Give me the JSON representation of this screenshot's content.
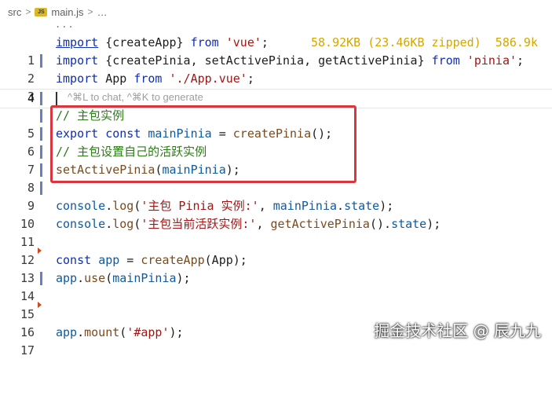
{
  "breadcrumb": {
    "folder": "src",
    "file_icon": "JS",
    "file": "main.js",
    "ellipsis": "…"
  },
  "fold_dots": "...",
  "editor": {
    "size_info": "58.92KB (23.46KB zipped)  586.9k",
    "hint": "^⌘L to chat, ^⌘K to generate",
    "line_numbers": [
      "1",
      "2",
      "3",
      "4",
      "5",
      "6",
      "7",
      "8",
      "9",
      "10",
      "11",
      "12",
      "13",
      "14",
      "15",
      "16",
      "17"
    ],
    "lines": {
      "l1": [
        "import",
        " {createApp} ",
        "from",
        " ",
        "'vue'",
        ";"
      ],
      "l2": [
        "import",
        " {createPinia, setActivePinia, getActivePinia} ",
        "from",
        " ",
        "'pinia'",
        ";"
      ],
      "l3": [
        "import",
        " App ",
        "from",
        " ",
        "'./App.vue'",
        ";"
      ],
      "l5": [
        "// 主包实例"
      ],
      "l6": [
        "export",
        " ",
        "const",
        " ",
        "mainPinia",
        " = ",
        "createPinia",
        "();"
      ],
      "l7": [
        "// 主包设置自己的活跃实例"
      ],
      "l8": [
        "setActivePinia",
        "(",
        "mainPinia",
        ");"
      ],
      "l10": [
        "console",
        ".",
        "log",
        "(",
        "'主包 Pinia 实例:'",
        ", ",
        "mainPinia",
        ".",
        "state",
        ");"
      ],
      "l11": [
        "console",
        ".",
        "log",
        "(",
        "'主包当前活跃实例:'",
        ", ",
        "getActivePinia",
        "().",
        "state",
        ");"
      ],
      "l13": [
        "const",
        " ",
        "app",
        " = ",
        "createApp",
        "(App);"
      ],
      "l14": [
        "app",
        ".",
        "use",
        "(",
        "mainPinia",
        ");"
      ],
      "l17": [
        "app",
        ".",
        "mount",
        "(",
        "'#app'",
        ");"
      ]
    }
  },
  "watermark": "掘金技术社区 @ 辰九九",
  "colors": {
    "keyword": "#0f2fb4",
    "function": "#7a4a1c",
    "string": "#a31515",
    "variable": "#0f5aa0",
    "comment": "#2b7a16",
    "size_info": "#d4a600",
    "highlight_box": "#d9363e"
  }
}
